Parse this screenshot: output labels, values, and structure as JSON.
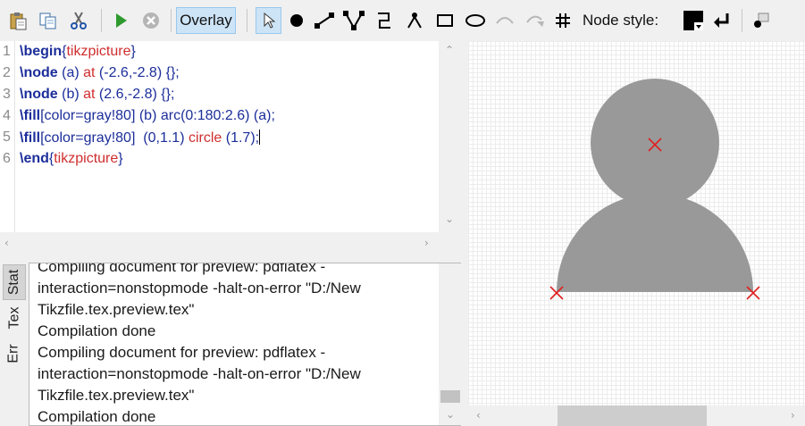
{
  "toolbar": {
    "overlay_label": "Overlay",
    "node_style_label": "Node style:"
  },
  "editor": {
    "line_numbers": [
      "1",
      "2",
      "3",
      "4",
      "5",
      "6"
    ],
    "lines": [
      [
        {
          "t": "\\begin",
          "c": "kw"
        },
        {
          "t": "{",
          "c": "nm"
        },
        {
          "t": "tikzpicture",
          "c": "rd"
        },
        {
          "t": "}",
          "c": "nm"
        }
      ],
      [
        {
          "t": "\\node",
          "c": "kw"
        },
        {
          "t": " (a) ",
          "c": "nm"
        },
        {
          "t": "at",
          "c": "rd"
        },
        {
          "t": " (-2.6,-2.8) {};",
          "c": "nm"
        }
      ],
      [
        {
          "t": "\\node",
          "c": "kw"
        },
        {
          "t": " (b) ",
          "c": "nm"
        },
        {
          "t": "at",
          "c": "rd"
        },
        {
          "t": " (2.6,-2.8) {};",
          "c": "nm"
        }
      ],
      [
        {
          "t": "\\fill",
          "c": "kw"
        },
        {
          "t": "[color=gray!80] (b) arc(0:180:2.6) (a);",
          "c": "nm"
        }
      ],
      [
        {
          "t": "\\fill",
          "c": "kw"
        },
        {
          "t": "[color=gray!80]  (0,1.1) ",
          "c": "nm"
        },
        {
          "t": "circle",
          "c": "rd"
        },
        {
          "t": " (1.7);",
          "c": "nm"
        }
      ],
      [
        {
          "t": "\\end",
          "c": "kw"
        },
        {
          "t": "{",
          "c": "nm"
        },
        {
          "t": "tikzpicture",
          "c": "rd"
        },
        {
          "t": "}",
          "c": "nm"
        }
      ]
    ]
  },
  "log": {
    "tabs": [
      "Stat",
      "Tex",
      "Err"
    ],
    "lines": [
      "Compiling document for preview: pdflatex -",
      "interaction=nonstopmode -halt-on-error \"D:/New",
      "Tikzfile.tex.preview.tex\"",
      "Compilation done",
      "Compiling document for preview: pdflatex -",
      "interaction=nonstopmode -halt-on-error \"D:/New",
      "Tikzfile.tex.preview.tex\"",
      "Compilation done"
    ]
  },
  "preview": {
    "fill_color": "#999999",
    "marker_color": "#e02020",
    "icons": [
      "node-marker-x-icon"
    ]
  },
  "icons": [
    "paste-icon",
    "copy-icon",
    "cut-icon",
    "run-icon",
    "stop-icon",
    "select-arrow-icon",
    "node-icon",
    "edge-icon",
    "v-edge-icon",
    "zigzag-edge-icon",
    "tree-icon",
    "rectangle-icon",
    "ellipse-icon",
    "arc-icon",
    "arc-arrow-icon",
    "grid-icon",
    "color-swatch-icon",
    "return-icon",
    "paint-bucket-icon"
  ]
}
